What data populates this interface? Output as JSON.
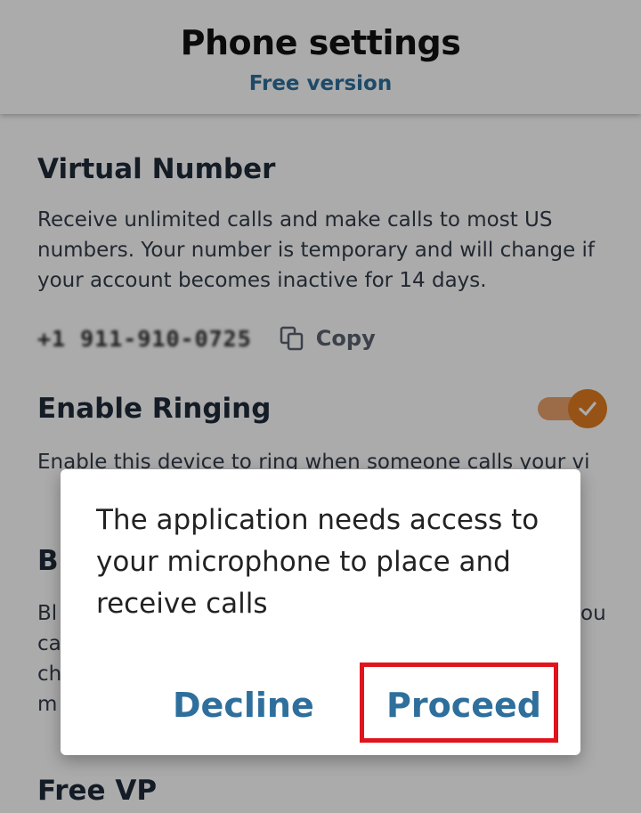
{
  "header": {
    "title": "Phone settings",
    "subtitle": "Free version"
  },
  "virtual_number": {
    "title": "Virtual Number",
    "description": "Receive unlimited calls and make calls to most US numbers. Your number is temporary and will change if your account becomes inactive for 14 days.",
    "number": "+1 911-910-0725",
    "copy_label": "Copy"
  },
  "ringing": {
    "title": "Enable Ringing",
    "description": "Enable this device to ring when someone calls your vi",
    "enabled": true
  },
  "block": {
    "title": "Bl",
    "text_lines": [
      "Bl",
      "ca",
      "ch",
      "m"
    ],
    "right_fragment": "ou"
  },
  "vpn": {
    "title": "Free VP"
  },
  "dialog": {
    "message": "The application needs access to your microphone to place and receive calls",
    "decline_label": "Decline",
    "proceed_label": "Proceed"
  },
  "colors": {
    "accent": "#2e6f9c",
    "toggle_on": "#e07d20",
    "highlight": "#e0141c"
  },
  "icons": [
    "copy-icon",
    "check-icon"
  ]
}
